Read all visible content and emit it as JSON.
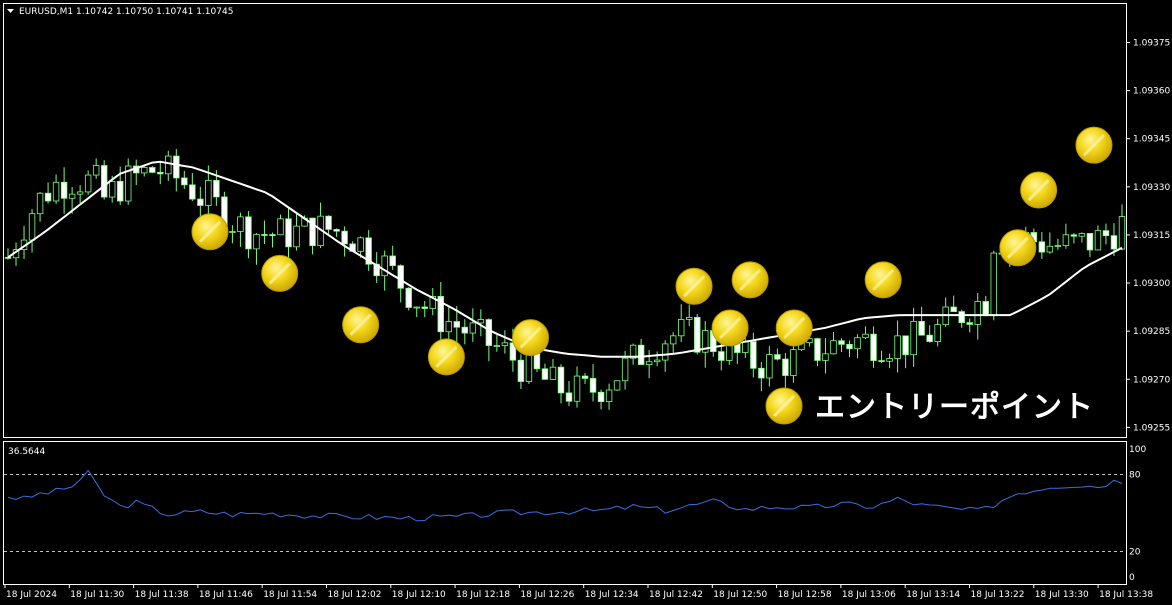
{
  "chart_header": {
    "symbol_line": "EURUSD,M1  1.10742 1.10750 1.10741 1.10745",
    "dropdown_icon": "triangle-down-icon"
  },
  "colors": {
    "background": "#000000",
    "frame": "#ffffff",
    "candle_up_fill": "#000000",
    "candle_up_border": "#7CFC7C",
    "candle_down_fill": "#ffffff",
    "candle_down_border": "#7CFC7C",
    "moving_average": "#ffffff",
    "oscillator_line": "#3B6FE0",
    "oscillator_levels": "#ffffff",
    "marker_gold": "#F2D21B"
  },
  "chart_data": [
    {
      "type": "candlestick",
      "title": "",
      "price_ticks": [
        "1.09375",
        "1.09360",
        "1.09345",
        "1.09330",
        "1.09315",
        "1.09300",
        "1.09285",
        "1.09270",
        "1.09255"
      ],
      "price_range": [
        1.09252,
        1.09387
      ],
      "time_labels": [
        "18 Jul 2024",
        "18 Jul 11:30",
        "18 Jul 11:38",
        "18 Jul 11:46",
        "18 Jul 11:54",
        "18 Jul 12:02",
        "18 Jul 12:10",
        "18 Jul 12:18",
        "18 Jul 12:26",
        "18 Jul 12:34",
        "18 Jul 12:42",
        "18 Jul 12:50",
        "18 Jul 12:58",
        "18 Jul 13:06",
        "18 Jul 13:14",
        "18 Jul 13:22",
        "18 Jul 13:30",
        "18 Jul 13:38"
      ],
      "moving_average": [
        1.09308,
        1.09316,
        1.09325,
        1.09334,
        1.09338,
        1.09336,
        1.09332,
        1.09328,
        1.0932,
        1.09312,
        1.09305,
        1.09298,
        1.09292,
        1.09285,
        1.0928,
        1.09278,
        1.09277,
        1.09277,
        1.09278,
        1.0928,
        1.09282,
        1.09284,
        1.09286,
        1.09289,
        1.0929,
        1.0929,
        1.0929,
        1.0929,
        1.09296,
        1.09305,
        1.09311
      ],
      "entry_points": [
        {
          "time_index": 25.7,
          "price": 1.09316
        },
        {
          "time_index": 34.4,
          "price": 1.09303
        },
        {
          "time_index": 44.5,
          "price": 1.09287
        },
        {
          "time_index": 55.2,
          "price": 1.09277
        },
        {
          "time_index": 65.7,
          "price": 1.09283
        },
        {
          "time_index": 86.1,
          "price": 1.09299
        },
        {
          "time_index": 90.6,
          "price": 1.09286
        },
        {
          "time_index": 93.1,
          "price": 1.09301
        },
        {
          "time_index": 98.6,
          "price": 1.09286
        },
        {
          "time_index": 109.7,
          "price": 1.09301
        },
        {
          "time_index": 126.5,
          "price": 1.09311
        },
        {
          "time_index": 129.1,
          "price": 1.09329
        },
        {
          "time_index": 136.0,
          "price": 1.09343
        }
      ],
      "legend_label": "エントリーポイント"
    },
    {
      "type": "line",
      "title": "",
      "value_label": "36.5644",
      "ylim": [
        0,
        100
      ],
      "y_ticks": [
        "100",
        "80",
        "20",
        "0"
      ],
      "levels": [
        80,
        20
      ],
      "values": [
        {
          "t": 0,
          "v": 63
        },
        {
          "t": 2,
          "v": 61
        },
        {
          "t": 4,
          "v": 65
        },
        {
          "t": 6,
          "v": 67
        },
        {
          "t": 8,
          "v": 71
        },
        {
          "t": 10,
          "v": 81
        },
        {
          "t": 12,
          "v": 64
        },
        {
          "t": 14,
          "v": 55
        },
        {
          "t": 16,
          "v": 58
        },
        {
          "t": 20,
          "v": 49
        },
        {
          "t": 24,
          "v": 51
        },
        {
          "t": 28,
          "v": 49
        },
        {
          "t": 32,
          "v": 50
        },
        {
          "t": 38,
          "v": 48
        },
        {
          "t": 44,
          "v": 47
        },
        {
          "t": 50,
          "v": 46
        },
        {
          "t": 56,
          "v": 47
        },
        {
          "t": 62,
          "v": 50
        },
        {
          "t": 68,
          "v": 51
        },
        {
          "t": 74,
          "v": 52
        },
        {
          "t": 78,
          "v": 55
        },
        {
          "t": 82,
          "v": 52
        },
        {
          "t": 88,
          "v": 59
        },
        {
          "t": 92,
          "v": 53
        },
        {
          "t": 96,
          "v": 55
        },
        {
          "t": 100,
          "v": 54
        },
        {
          "t": 104,
          "v": 57
        },
        {
          "t": 108,
          "v": 55
        },
        {
          "t": 111,
          "v": 61
        },
        {
          "t": 114,
          "v": 56
        },
        {
          "t": 117,
          "v": 54
        },
        {
          "t": 120,
          "v": 52
        },
        {
          "t": 122,
          "v": 53
        },
        {
          "t": 124,
          "v": 60
        },
        {
          "t": 126,
          "v": 66
        },
        {
          "t": 128,
          "v": 68
        },
        {
          "t": 130,
          "v": 71
        },
        {
          "t": 133,
          "v": 72
        },
        {
          "t": 136,
          "v": 71
        },
        {
          "t": 138,
          "v": 75
        }
      ]
    }
  ]
}
